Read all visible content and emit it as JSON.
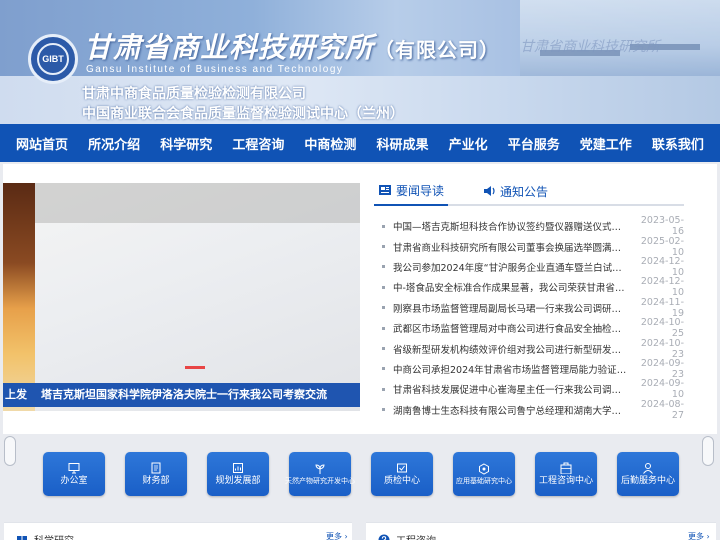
{
  "header": {
    "logo_text": "GIBT",
    "calligraphy_title": "甘肃省商业科技研究所",
    "calligraphy_suffix": "（有限公司）",
    "english_name": "Gansu Institute of Business and Technology",
    "org_line_1": "甘肃中商食品质量检验检测有限公司",
    "org_line_2": "中国商业联合会食品质量监督检验测试中心（兰州）"
  },
  "nav": {
    "items": [
      "网站首页",
      "所况介绍",
      "科学研究",
      "工程咨询",
      "中商检测",
      "科研成果",
      "产业化",
      "平台服务",
      "党建工作",
      "联系我们"
    ]
  },
  "slider": {
    "caption_prefix": "上发",
    "caption": "塔吉克斯坦国家科学院伊洛洛夫院士一行来我公司考察交流"
  },
  "news": {
    "tab_news": "要闻导读",
    "tab_notice": "通知公告",
    "items": [
      {
        "title": "中国—塔吉克斯坦科技合作协议签约暨仪器赠送仪式在…",
        "date": "2023-05-16"
      },
      {
        "title": "甘肃省商业科技研究所有限公司董事会换届选举圆满完成",
        "date": "2025-02-10"
      },
      {
        "title": "我公司参加2024年度“甘沪服务企业直通车暨兰白试验区…",
        "date": "2024-12-10"
      },
      {
        "title": "中-塔食品安全标准合作成果显著，我公司荣获甘肃省市…",
        "date": "2024-12-10"
      },
      {
        "title": "刚察县市场监督管理局副局长马珺一行来我公司调研考察",
        "date": "2024-11-19"
      },
      {
        "title": "武都区市场监督管理局对中商公司进行食品安全抽检承…",
        "date": "2024-10-25"
      },
      {
        "title": "省级新型研发机构绩效评价组对我公司进行新型研发机…",
        "date": "2024-10-23"
      },
      {
        "title": "中商公司承担2024年甘肃省市场监督管理局能力验证项目",
        "date": "2024-09-23"
      },
      {
        "title": "甘肃省科技发展促进中心崔海星主任一行来我公司调研…",
        "date": "2024-09-10"
      },
      {
        "title": "湖南鲁博士生态科技有限公司鲁宁总经理和湖南大学宋…",
        "date": "2024-08-27"
      }
    ]
  },
  "departments": [
    {
      "label": "办公室",
      "icon": "monitor-icon"
    },
    {
      "label": "财务部",
      "icon": "ledger-icon"
    },
    {
      "label": "规划发展部",
      "icon": "chart-icon"
    },
    {
      "label": "天然产物研究开发中心",
      "icon": "leaf-icon"
    },
    {
      "label": "质检中心",
      "icon": "inspection-icon"
    },
    {
      "label": "应用基础研究中心",
      "icon": "research-icon"
    },
    {
      "label": "工程咨询中心",
      "icon": "consult-icon"
    },
    {
      "label": "后勤服务中心",
      "icon": "service-icon"
    }
  ],
  "sections": {
    "left_title": "科学研究",
    "left_more": "更多 ›",
    "right_title": "工程咨询",
    "right_more": "更多 ›"
  },
  "colors": {
    "nav_bg": "#1053b5",
    "accent": "#1053b5",
    "dept_bg": "#1a5fc7",
    "slider_dot": "#e84545"
  }
}
